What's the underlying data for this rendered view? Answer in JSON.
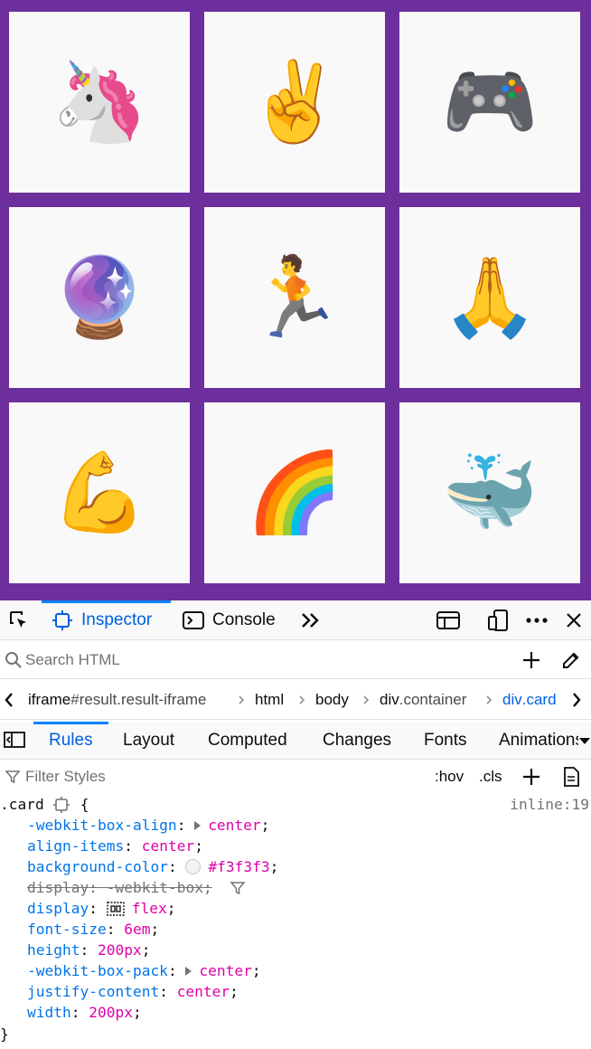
{
  "cards": [
    {
      "emoji": "🦄",
      "icon": "unicorn-emoji"
    },
    {
      "emoji": "✌️",
      "icon": "victory-hand-emoji"
    },
    {
      "emoji": "🎮",
      "icon": "game-controller-emoji"
    },
    {
      "emoji": "🔮",
      "icon": "crystal-ball-emoji"
    },
    {
      "emoji": "🏃",
      "icon": "running-person-emoji"
    },
    {
      "emoji": "🙏",
      "icon": "folded-hands-emoji"
    },
    {
      "emoji": "💪",
      "icon": "flexed-biceps-emoji"
    },
    {
      "emoji": "🌈",
      "icon": "rainbow-emoji"
    },
    {
      "emoji": "🐳",
      "icon": "spouting-whale-emoji"
    }
  ],
  "colors": {
    "page_bg": "#6c2f9c",
    "card_bg": "#f9f9f9",
    "accent": "#0060df"
  },
  "toolbar": {
    "inspector": "Inspector",
    "console": "Console"
  },
  "search": {
    "placeholder": "Search HTML"
  },
  "breadcrumb": {
    "items": [
      {
        "tag": "iframe",
        "rest": "#result.result-iframe"
      },
      {
        "tag": "html",
        "rest": ""
      },
      {
        "tag": "body",
        "rest": ""
      },
      {
        "tag": "div",
        "rest": ".container"
      },
      {
        "tag": "div",
        "rest": ".card"
      }
    ]
  },
  "subtabs": [
    "Rules",
    "Layout",
    "Computed",
    "Changes",
    "Fonts",
    "Animations"
  ],
  "filter": {
    "placeholder": "Filter Styles",
    "hov": ":hov",
    "cls": ".cls"
  },
  "rule": {
    "selector": ".card",
    "open": "{",
    "close": "}",
    "source": "inline:19",
    "declarations": [
      {
        "name": "-webkit-box-align",
        "value": "center",
        "twisty": true
      },
      {
        "name": "align-items",
        "value": "center"
      },
      {
        "name": "background-color",
        "value": "#f3f3f3",
        "swatch": true
      },
      {
        "name": "display",
        "value": "-webkit-box",
        "overridden": true
      },
      {
        "name": "display",
        "value": "flex",
        "flexbadge": true
      },
      {
        "name": "font-size",
        "value": "6em"
      },
      {
        "name": "height",
        "value": "200px"
      },
      {
        "name": "-webkit-box-pack",
        "value": "center",
        "twisty": true
      },
      {
        "name": "justify-content",
        "value": "center"
      },
      {
        "name": "width",
        "value": "200px"
      }
    ]
  }
}
